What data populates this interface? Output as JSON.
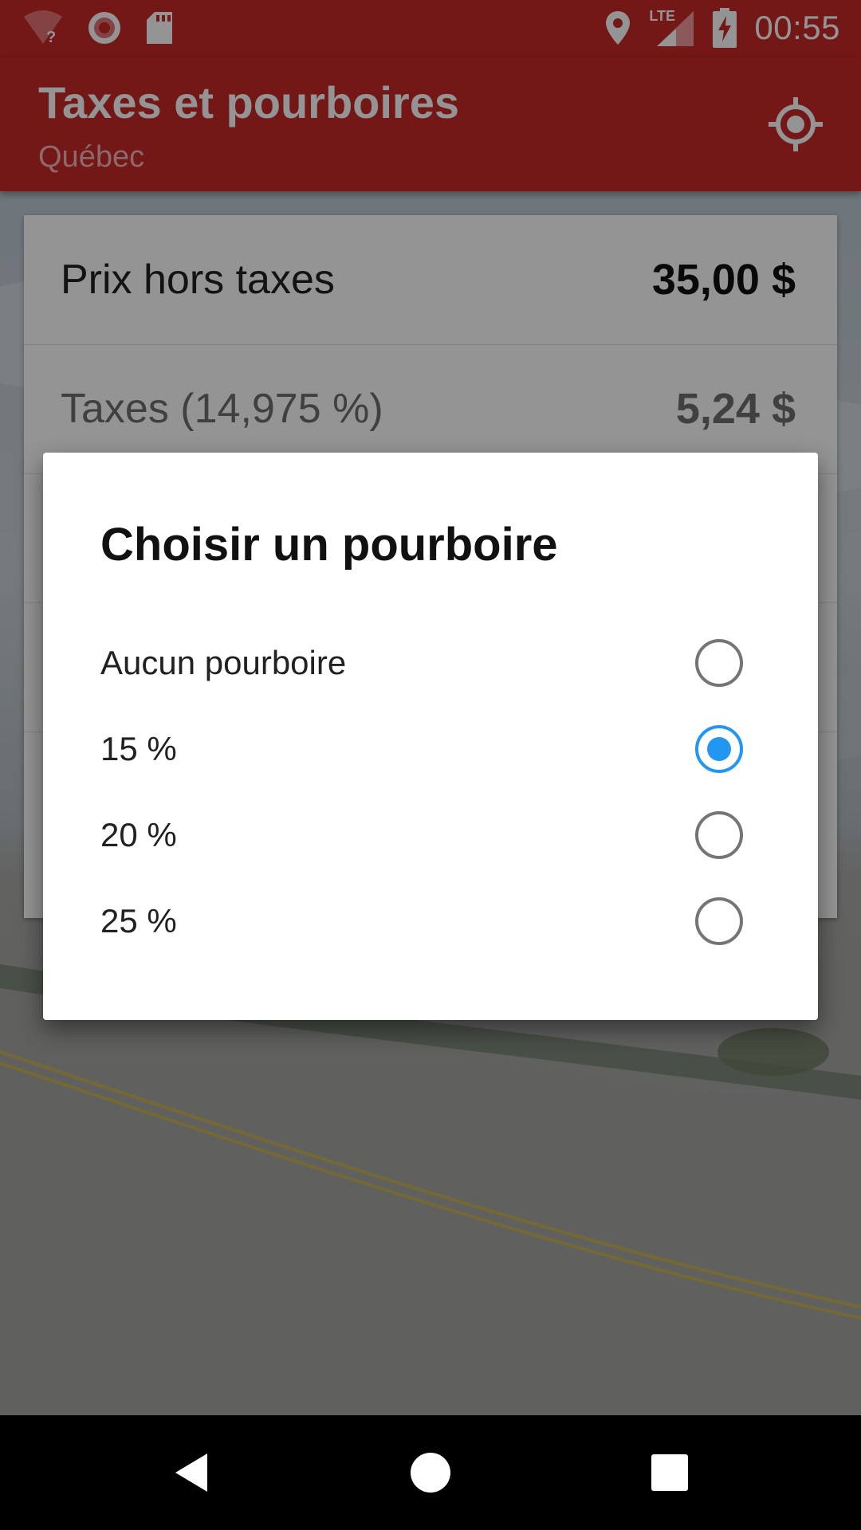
{
  "status_bar": {
    "time": "00:55",
    "network_label": "LTE",
    "icons": [
      "wifi-question-icon",
      "record-icon",
      "sd-card-icon",
      "location-pin-icon",
      "signal-icon",
      "battery-charging-icon"
    ]
  },
  "app_bar": {
    "title": "Taxes et pourboires",
    "subtitle": "Québec",
    "action_icon": "my-location-icon"
  },
  "card": {
    "rows": [
      {
        "label": "Prix hors taxes",
        "value": "35,00  $"
      },
      {
        "label": "Taxes (14,975 %)",
        "value": "5,24  $"
      }
    ]
  },
  "dialog": {
    "title": "Choisir un pourboire",
    "options": [
      {
        "label": "Aucun pourboire",
        "selected": false
      },
      {
        "label": "15 %",
        "selected": true
      },
      {
        "label": "20 %",
        "selected": false
      },
      {
        "label": "25 %",
        "selected": false
      }
    ]
  },
  "nav_bar": {
    "buttons": [
      "back-icon",
      "home-icon",
      "recents-icon"
    ]
  },
  "colors": {
    "primary": "#c62828",
    "accent": "#2196f3"
  }
}
